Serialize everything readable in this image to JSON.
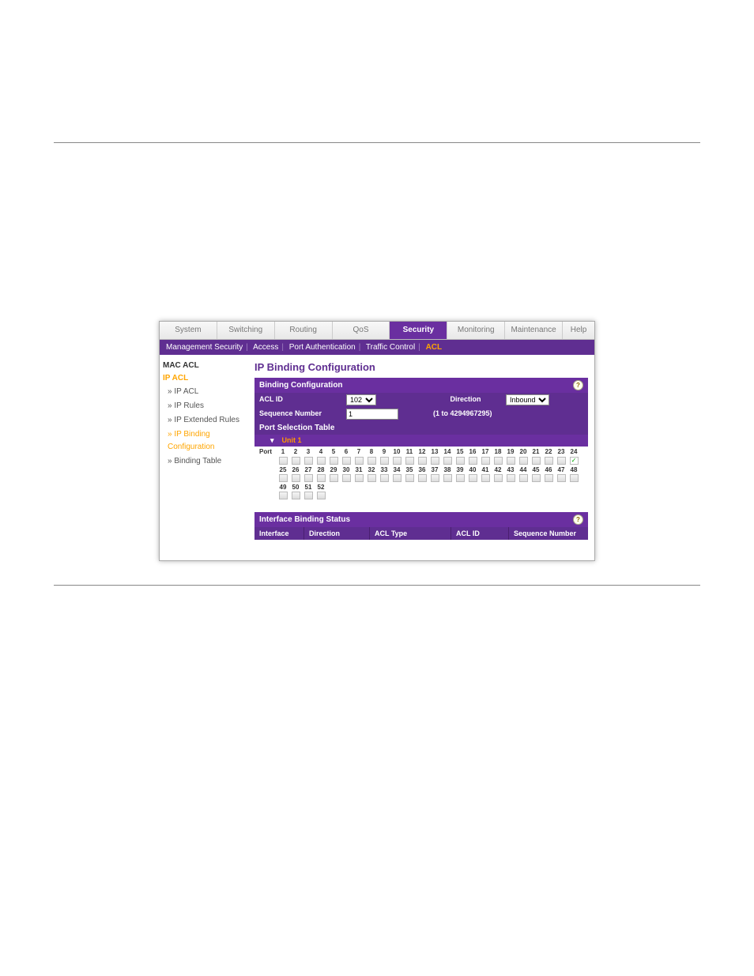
{
  "tabs": {
    "system": "System",
    "switching": "Switching",
    "routing": "Routing",
    "qos": "QoS",
    "security": "Security",
    "monitoring": "Monitoring",
    "maintenance": "Maintenance",
    "help": "Help"
  },
  "subnav": {
    "mgmt": "Management Security",
    "access": "Access",
    "portauth": "Port Authentication",
    "traffic": "Traffic Control",
    "acl": "ACL"
  },
  "side": {
    "macacl": "MAC ACL",
    "ipacl": "IP ACL",
    "items": {
      "ipacl": "» IP ACL",
      "iprules": "» IP Rules",
      "ipext": "» IP Extended Rules",
      "ipbind": "» IP Binding Configuration",
      "bindtbl": "» Binding Table"
    }
  },
  "title": "IP Binding Configuration",
  "binding": {
    "hdr": "Binding Configuration",
    "aclid_label": "ACL ID",
    "aclid_value": "102",
    "dir_label": "Direction",
    "dir_value": "Inbound",
    "seq_label": "Sequence Number",
    "seq_value": "1",
    "seq_hint": "(1 to 4294967295)",
    "pst": "Port Selection Table",
    "unit": "Unit 1",
    "port_label": "Port"
  },
  "ports": {
    "row1": [
      "1",
      "2",
      "3",
      "4",
      "5",
      "6",
      "7",
      "8",
      "9",
      "10",
      "11",
      "12",
      "13",
      "14",
      "15",
      "16",
      "17",
      "18",
      "19",
      "20",
      "21",
      "22",
      "23",
      "24"
    ],
    "row2": [
      "25",
      "26",
      "27",
      "28",
      "29",
      "30",
      "31",
      "32",
      "33",
      "34",
      "35",
      "36",
      "37",
      "38",
      "39",
      "40",
      "41",
      "42",
      "43",
      "44",
      "45",
      "46",
      "47",
      "48"
    ],
    "row3": [
      "49",
      "50",
      "51",
      "52"
    ],
    "checked_port": "24"
  },
  "ibs": {
    "hdr": "Interface Binding Status",
    "cols": {
      "iface": "Interface",
      "dir": "Direction",
      "type": "ACL Type",
      "id": "ACL ID",
      "seq": "Sequence Number"
    }
  }
}
